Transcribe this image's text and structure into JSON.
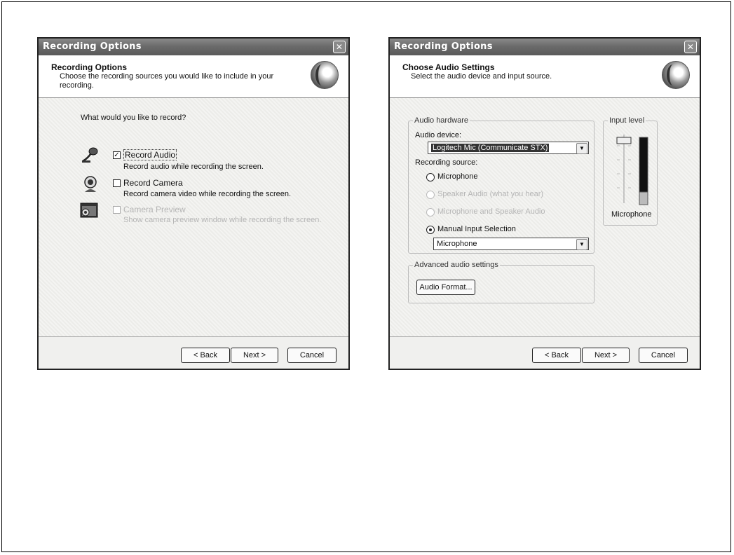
{
  "dialog1": {
    "title": "Recording Options",
    "header_title": "Recording Options",
    "header_desc": "Choose the recording sources you would like to include in your recording.",
    "question": "What would you like to record?",
    "options": [
      {
        "label": "Record Audio",
        "description": "Record audio while recording the screen.",
        "checked": true,
        "enabled": true,
        "icon": "microphone-icon"
      },
      {
        "label": "Record Camera",
        "description": "Record camera video while recording the screen.",
        "checked": false,
        "enabled": true,
        "icon": "webcam-icon"
      },
      {
        "label": "Camera Preview",
        "description": "Show camera preview window while recording the screen.",
        "checked": false,
        "enabled": false,
        "icon": "camera-preview-icon"
      }
    ],
    "buttons": {
      "back": "< Back",
      "next": "Next >",
      "cancel": "Cancel"
    }
  },
  "dialog2": {
    "title": "Recording Options",
    "header_title": "Choose Audio Settings",
    "header_desc": "Select the audio device and input source.",
    "audio_hardware": {
      "group_label": "Audio hardware",
      "device_label": "Audio device:",
      "device_value": "Logitech Mic (Communicate STX)",
      "source_label": "Recording source:",
      "sources": [
        {
          "label": "Microphone",
          "enabled": true,
          "selected": false
        },
        {
          "label": "Speaker Audio (what you hear)",
          "enabled": false,
          "selected": false
        },
        {
          "label": "Microphone and Speaker Audio",
          "enabled": false,
          "selected": false
        },
        {
          "label": "Manual Input Selection",
          "enabled": true,
          "selected": true
        }
      ],
      "manual_input_value": "Microphone"
    },
    "input_level": {
      "group_label": "Input level",
      "caption": "Microphone"
    },
    "advanced": {
      "group_label": "Advanced audio settings",
      "button": "Audio Format..."
    },
    "buttons": {
      "back": "< Back",
      "next": "Next >",
      "cancel": "Cancel"
    }
  }
}
